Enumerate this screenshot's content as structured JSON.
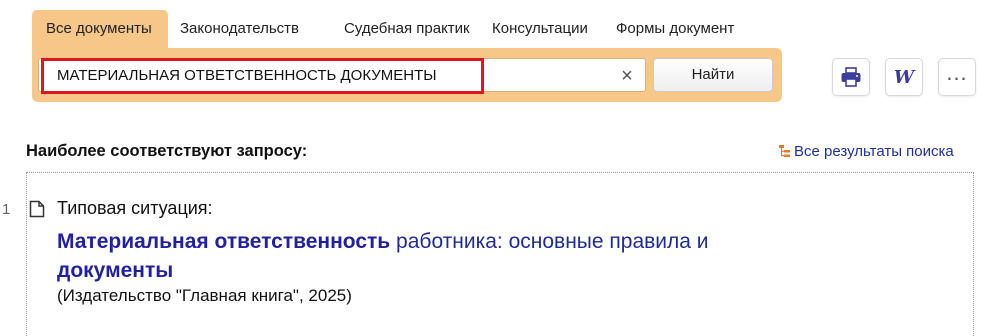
{
  "tabs": [
    {
      "label": "Все документы",
      "active": true
    },
    {
      "label": "Законодательств",
      "active": false
    },
    {
      "label": "Судебная практик",
      "active": false
    },
    {
      "label": "Консультации",
      "active": false
    },
    {
      "label": "Формы документ",
      "active": false
    }
  ],
  "search": {
    "value": "МАТЕРИАЛЬНАЯ ОТВЕТСТВЕННОСТЬ ДОКУМЕНТЫ",
    "clear_symbol": "×",
    "find_label": "Найти"
  },
  "toolbar": {
    "print_icon": "printer-icon",
    "word_label": "W",
    "more_label": "..."
  },
  "results": {
    "heading": "Наиболее соответствуют запросу:",
    "all_results_label": "Все результаты поиска",
    "items": [
      {
        "index": "1",
        "type": "Типовая ситуация:",
        "title_bold_1": "Материальная ответственность",
        "title_normal": " работника: основные правила и ",
        "title_bold_2": "документы",
        "source": "(Издательство \"Главная книга\", 2025)"
      }
    ]
  },
  "colors": {
    "accent": "#f6c788",
    "highlight_border": "#e0161e",
    "link": "#1f2a9e"
  }
}
